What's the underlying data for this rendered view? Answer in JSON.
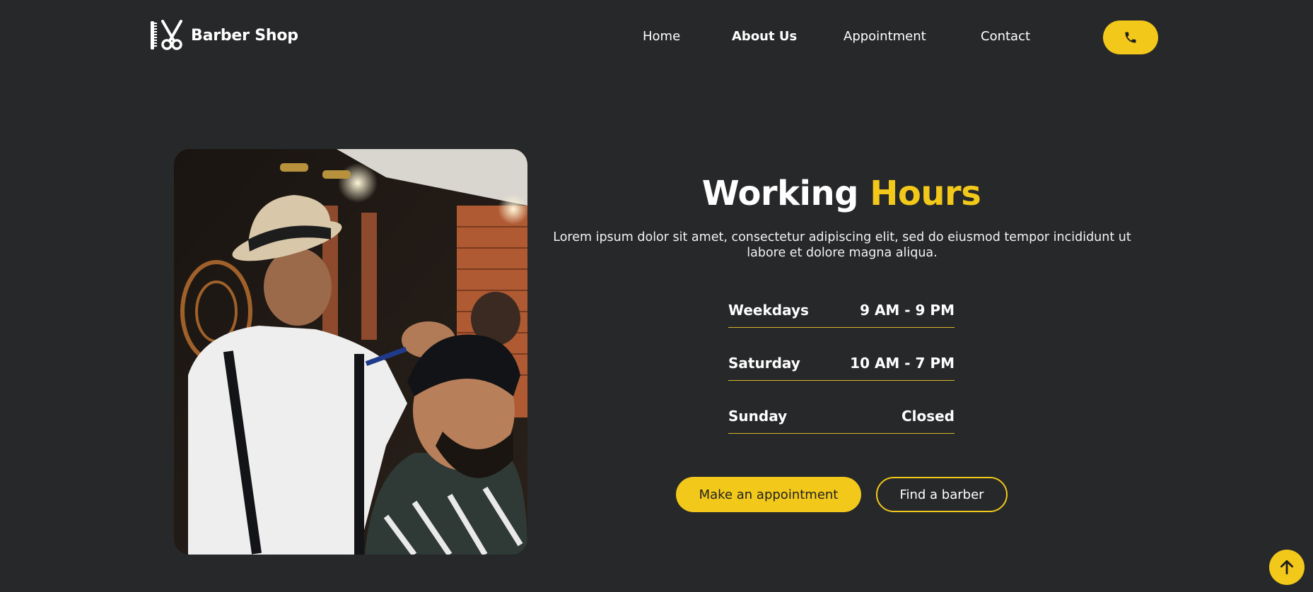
{
  "brand": {
    "name": "Barber Shop",
    "logo_icon": "comb-scissors-icon"
  },
  "nav": {
    "items": [
      {
        "label": "Home",
        "active": false
      },
      {
        "label": "About Us",
        "active": true
      },
      {
        "label": "Appointment",
        "active": false
      },
      {
        "label": "Contact",
        "active": false
      }
    ],
    "phone_icon": "phone-icon"
  },
  "hero": {
    "image_alt": "Barber styling a customer's hair",
    "title_part1": "Working",
    "title_part2": "Hours",
    "description": "Lorem ipsum dolor sit amet, consectetur adipiscing elit, sed do eiusmod tempor incididunt ut labore et dolore magna aliqua.",
    "hours": [
      {
        "day": "Weekdays",
        "time": "9 AM - 9 PM"
      },
      {
        "day": "Saturday",
        "time": "10 AM - 7 PM"
      },
      {
        "day": "Sunday",
        "time": "Closed"
      }
    ],
    "primary_button": "Make an appointment",
    "secondary_button": "Find a barber"
  },
  "scroll_top_icon": "arrow-up-icon",
  "colors": {
    "background": "#27282a",
    "accent": "#f2c81a",
    "text": "#ffffff"
  }
}
